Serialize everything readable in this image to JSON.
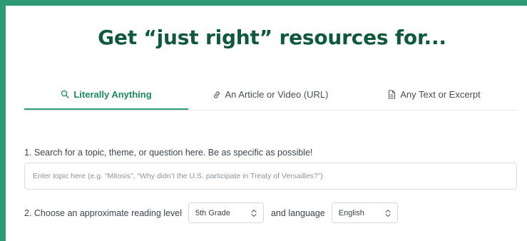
{
  "headline": "Get “just right” resources for...",
  "tabs": [
    {
      "label": "Literally Anything",
      "icon": "search-icon",
      "active": true
    },
    {
      "label": "An Article or Video (URL)",
      "icon": "link-icon",
      "active": false
    },
    {
      "label": "Any Text or Excerpt",
      "icon": "document-icon",
      "active": false
    }
  ],
  "step1": {
    "label": "1. Search for a topic, theme, or question here. Be as specific as possible!",
    "placeholder": "Enter topic here (e.g. “Mitosis”, “Why didn’t the U.S. participate in Treaty of Versailles?”)",
    "value": ""
  },
  "step2": {
    "label": "2. Choose an approximate reading level",
    "reading_level": "5th Grade",
    "language_label": "and language",
    "language": "English"
  },
  "colors": {
    "accent": "#2e9a73",
    "headline": "#0f5a3c",
    "active_tab": "#19885f"
  }
}
